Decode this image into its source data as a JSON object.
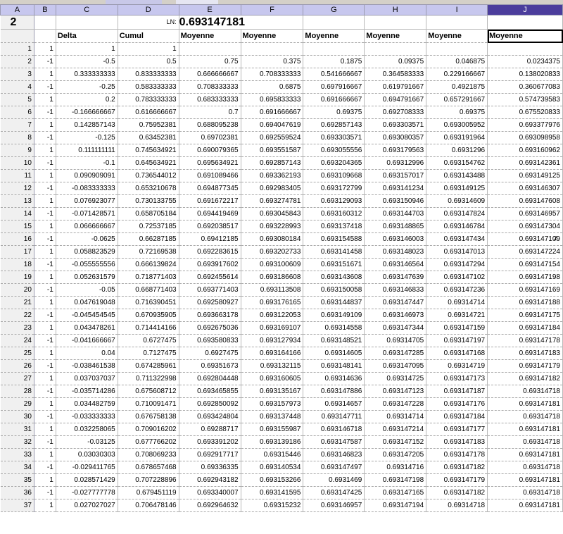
{
  "columns": [
    "A",
    "B",
    "C",
    "D",
    "E",
    "F",
    "G",
    "H",
    "I",
    "J"
  ],
  "row1": {
    "a": "2",
    "ln_label": "LN:",
    "ln_value": "0.693147181"
  },
  "headers": {
    "delta": "Delta",
    "cumul": "Cumul",
    "moyenne": "Moyenne"
  },
  "side_note": "z",
  "rows": [
    [
      "1",
      "1",
      "1",
      "1",
      "",
      "",
      "",
      "",
      "",
      ""
    ],
    [
      "2",
      "-1",
      "-0.5",
      "0.5",
      "0.75",
      "0.375",
      "0.1875",
      "0.09375",
      "0.046875",
      "0.0234375"
    ],
    [
      "3",
      "1",
      "0.333333333",
      "0.833333333",
      "0.666666667",
      "0.708333333",
      "0.541666667",
      "0.364583333",
      "0.229166667",
      "0.138020833"
    ],
    [
      "4",
      "-1",
      "-0.25",
      "0.583333333",
      "0.708333333",
      "0.6875",
      "0.697916667",
      "0.619791667",
      "0.4921875",
      "0.360677083"
    ],
    [
      "5",
      "1",
      "0.2",
      "0.783333333",
      "0.683333333",
      "0.695833333",
      "0.691666667",
      "0.694791667",
      "0.657291667",
      "0.574739583"
    ],
    [
      "6",
      "-1",
      "-0.166666667",
      "0.616666667",
      "0.7",
      "0.691666667",
      "0.69375",
      "0.692708333",
      "0.69375",
      "0.675520833"
    ],
    [
      "7",
      "1",
      "0.142857143",
      "0.75952381",
      "0.688095238",
      "0.694047619",
      "0.692857143",
      "0.693303571",
      "0.693005952",
      "0.693377976"
    ],
    [
      "8",
      "-1",
      "-0.125",
      "0.63452381",
      "0.69702381",
      "0.692559524",
      "0.693303571",
      "0.693080357",
      "0.693191964",
      "0.693098958"
    ],
    [
      "9",
      "1",
      "0.111111111",
      "0.745634921",
      "0.690079365",
      "0.693551587",
      "0.693055556",
      "0.693179563",
      "0.6931296",
      "0.693160962"
    ],
    [
      "10",
      "-1",
      "-0.1",
      "0.645634921",
      "0.695634921",
      "0.692857143",
      "0.693204365",
      "0.69312996",
      "0.693154762",
      "0.693142361"
    ],
    [
      "11",
      "1",
      "0.090909091",
      "0.736544012",
      "0.691089466",
      "0.693362193",
      "0.693109668",
      "0.693157017",
      "0.693143488",
      "0.693149125"
    ],
    [
      "12",
      "-1",
      "-0.083333333",
      "0.653210678",
      "0.694877345",
      "0.692983405",
      "0.693172799",
      "0.693141234",
      "0.693149125",
      "0.693146307"
    ],
    [
      "13",
      "1",
      "0.076923077",
      "0.730133755",
      "0.691672217",
      "0.693274781",
      "0.693129093",
      "0.693150946",
      "0.69314609",
      "0.693147608"
    ],
    [
      "14",
      "-1",
      "-0.071428571",
      "0.658705184",
      "0.694419469",
      "0.693045843",
      "0.693160312",
      "0.693144703",
      "0.693147824",
      "0.693146957"
    ],
    [
      "15",
      "1",
      "0.066666667",
      "0.72537185",
      "0.692038517",
      "0.693228993",
      "0.693137418",
      "0.693148865",
      "0.693146784",
      "0.693147304"
    ],
    [
      "16",
      "-1",
      "-0.0625",
      "0.66287185",
      "0.69412185",
      "0.693080184",
      "0.693154588",
      "0.693146003",
      "0.693147434",
      "0.693147109"
    ],
    [
      "17",
      "1",
      "0.058823529",
      "0.72169538",
      "0.692283615",
      "0.693202733",
      "0.693141458",
      "0.693148023",
      "0.693147013",
      "0.693147224"
    ],
    [
      "18",
      "-1",
      "-0.055555556",
      "0.666139824",
      "0.693917602",
      "0.693100609",
      "0.693151671",
      "0.693146564",
      "0.693147294",
      "0.693147154"
    ],
    [
      "19",
      "1",
      "0.052631579",
      "0.718771403",
      "0.692455614",
      "0.693186608",
      "0.693143608",
      "0.693147639",
      "0.693147102",
      "0.693147198"
    ],
    [
      "20",
      "-1",
      "-0.05",
      "0.668771403",
      "0.693771403",
      "0.693113508",
      "0.693150058",
      "0.693146833",
      "0.693147236",
      "0.693147169"
    ],
    [
      "21",
      "1",
      "0.047619048",
      "0.716390451",
      "0.692580927",
      "0.693176165",
      "0.693144837",
      "0.693147447",
      "0.69314714",
      "0.693147188"
    ],
    [
      "22",
      "-1",
      "-0.045454545",
      "0.670935905",
      "0.693663178",
      "0.693122053",
      "0.693149109",
      "0.693146973",
      "0.69314721",
      "0.693147175"
    ],
    [
      "23",
      "1",
      "0.043478261",
      "0.714414166",
      "0.692675036",
      "0.693169107",
      "0.69314558",
      "0.693147344",
      "0.693147159",
      "0.693147184"
    ],
    [
      "24",
      "-1",
      "-0.041666667",
      "0.6727475",
      "0.693580833",
      "0.693127934",
      "0.693148521",
      "0.69314705",
      "0.693147197",
      "0.693147178"
    ],
    [
      "25",
      "1",
      "0.04",
      "0.7127475",
      "0.6927475",
      "0.693164166",
      "0.69314605",
      "0.693147285",
      "0.693147168",
      "0.693147183"
    ],
    [
      "26",
      "-1",
      "-0.038461538",
      "0.674285961",
      "0.69351673",
      "0.693132115",
      "0.693148141",
      "0.693147095",
      "0.69314719",
      "0.693147179"
    ],
    [
      "27",
      "1",
      "0.037037037",
      "0.711322998",
      "0.692804448",
      "0.693160605",
      "0.69314636",
      "0.69314725",
      "0.693147173",
      "0.693147182"
    ],
    [
      "28",
      "-1",
      "-0.035714286",
      "0.675608712",
      "0.693465855",
      "0.693135167",
      "0.693147886",
      "0.693147123",
      "0.693147187",
      "0.69314718"
    ],
    [
      "29",
      "1",
      "0.034482759",
      "0.710091471",
      "0.692850092",
      "0.693157973",
      "0.69314657",
      "0.693147228",
      "0.693147176",
      "0.693147181"
    ],
    [
      "30",
      "-1",
      "-0.033333333",
      "0.676758138",
      "0.693424804",
      "0.693137448",
      "0.693147711",
      "0.69314714",
      "0.693147184",
      "0.69314718"
    ],
    [
      "31",
      "1",
      "0.032258065",
      "0.709016202",
      "0.69288717",
      "0.693155987",
      "0.693146718",
      "0.693147214",
      "0.693147177",
      "0.693147181"
    ],
    [
      "32",
      "-1",
      "-0.03125",
      "0.677766202",
      "0.693391202",
      "0.693139186",
      "0.693147587",
      "0.693147152",
      "0.693147183",
      "0.69314718"
    ],
    [
      "33",
      "1",
      "0.03030303",
      "0.708069233",
      "0.692917717",
      "0.69315446",
      "0.693146823",
      "0.693147205",
      "0.693147178",
      "0.693147181"
    ],
    [
      "34",
      "-1",
      "-0.029411765",
      "0.678657468",
      "0.69336335",
      "0.693140534",
      "0.693147497",
      "0.69314716",
      "0.693147182",
      "0.69314718"
    ],
    [
      "35",
      "1",
      "0.028571429",
      "0.707228896",
      "0.692943182",
      "0.693153266",
      "0.6931469",
      "0.693147198",
      "0.693147179",
      "0.693147181"
    ],
    [
      "36",
      "-1",
      "-0.027777778",
      "0.679451119",
      "0.693340007",
      "0.693141595",
      "0.693147425",
      "0.693147165",
      "0.693147182",
      "0.69314718"
    ],
    [
      "37",
      "1",
      "0.027027027",
      "0.706478146",
      "0.692964632",
      "0.69315232",
      "0.693146957",
      "0.693147194",
      "0.69314718",
      "0.693147181"
    ]
  ]
}
